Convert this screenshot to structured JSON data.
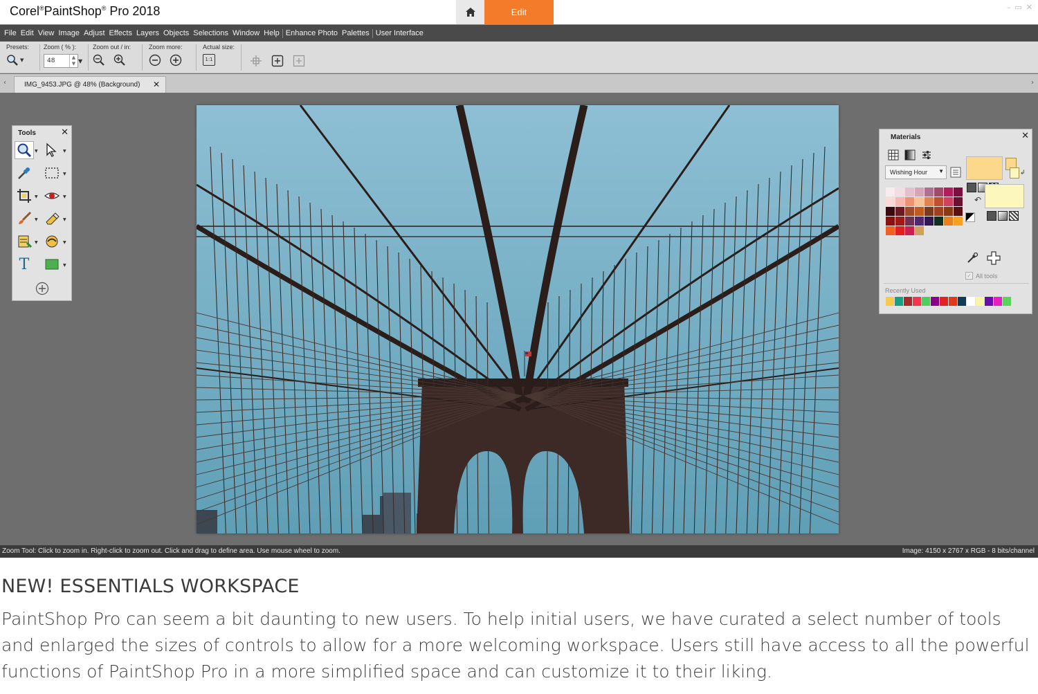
{
  "window": {
    "title_parts": [
      "Corel",
      "PaintShop",
      "Pro 2018"
    ],
    "edit_tab": "Edit",
    "controls": [
      "–",
      "▭",
      "✕"
    ]
  },
  "menubar": {
    "items": [
      "File",
      "Edit",
      "View",
      "Image",
      "Adjust",
      "Effects",
      "Layers",
      "Objects",
      "Selections",
      "Window",
      "Help",
      "Enhance Photo",
      "Palettes",
      "User Interface"
    ]
  },
  "toolbar": {
    "presets_label": "Presets:",
    "zoom_label": "Zoom ( % ):",
    "zoom_value": "48",
    "zoom_out_in_label": "Zoom out / in:",
    "zoom_more_label": "Zoom more:",
    "actual_size_label": "Actual size:",
    "actual_size_glyph": "1:1"
  },
  "document_tab": {
    "label": "IMG_9453.JPG @  48% (Background)",
    "close": "✕"
  },
  "tools_panel": {
    "title": "Tools",
    "close": "✕",
    "text_tool_glyph": "T"
  },
  "materials_panel": {
    "title": "Materials",
    "close": "✕",
    "swatch_set": "Wishing Hour",
    "all_tools_label": "All tools",
    "recently_used_label": "Recently Used",
    "foreground_color": "#fcd88c",
    "background_color": "#fbf7bd",
    "swatches": [
      "#f8ecec",
      "#f2dde2",
      "#e4c0cc",
      "#d4a6b8",
      "#b07090",
      "#a24a6c",
      "#b01e60",
      "#7b1040",
      "#fbd9d9",
      "#f6b8b0",
      "#ef9272",
      "#f8c196",
      "#e08454",
      "#c05030",
      "#d04060",
      "#6a1030",
      "#3a0a10",
      "#6a1a20",
      "#a04a2a",
      "#c05a20",
      "#7a3a1e",
      "#a04020",
      "#8a3a10",
      "#5a1010",
      "#8a1010",
      "#a01818",
      "#703050",
      "#502870",
      "#301850",
      "#103020",
      "#e88020",
      "#f8a020",
      "#f06020",
      "#e02020",
      "#c82050",
      "#d0a060"
    ],
    "recent": [
      "#f7c94d",
      "#16a184",
      "#a52a2a",
      "#f5344e",
      "#4ecd63",
      "#8b008b",
      "#e0231f",
      "#e03a1d",
      "#0e3c54",
      "#ffffff",
      "#f7f6a6",
      "#6a0dad",
      "#e91ebd",
      "#58d458"
    ]
  },
  "statusbar": {
    "left": "Zoom Tool: Click to zoom in. Right-click to zoom out. Click and drag to define area. Use mouse wheel to zoom.",
    "right": "Image:  4150 x 2767 x RGB - 8 bits/channel"
  },
  "caption": {
    "title": "NEW! ESSENTIALS WORKSPACE",
    "body": "PaintShop Pro can seem a bit daunting to new users. To help initial users, we have curated a select number of tools and enlarged the sizes of controls to allow for a more welcoming workspace. Users still have access to all the powerful functions of PaintShop Pro in a more simplified space and can customize it to their liking."
  },
  "colors": {
    "accent": "#f47b2a",
    "menubar": "#4a4a4a",
    "workspace": "#6e6e6e",
    "sky": "#7fb5cc"
  }
}
